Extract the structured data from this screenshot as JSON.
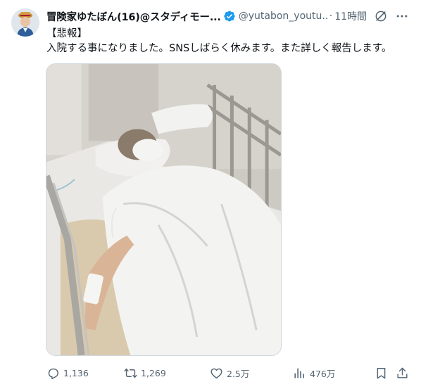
{
  "post": {
    "author": {
      "display_name": "冒険家ゆたぼん(16)@スタディモー...",
      "handle": "@yutabon_youtu...",
      "verified": true
    },
    "separator": "·",
    "time": "11時間",
    "text_lines": [
      "【悲報】",
      "入院する事になりました。SNSしばらく休みます。また詳しく報告します。"
    ],
    "media": {
      "kind": "photo"
    },
    "stats": {
      "replies": "1,136",
      "reposts": "1,269",
      "likes": "2.5万",
      "views": "476万"
    }
  },
  "icons": {
    "verified": "verified-badge-icon",
    "grok": "grok-icon",
    "more": "more-icon",
    "reply": "reply-icon",
    "repost": "repost-icon",
    "like": "like-icon",
    "views": "views-icon",
    "bookmark": "bookmark-icon",
    "share": "share-icon"
  },
  "colors": {
    "text": "#0f1419",
    "secondary": "#536471",
    "verified": "#1d9bf0"
  }
}
